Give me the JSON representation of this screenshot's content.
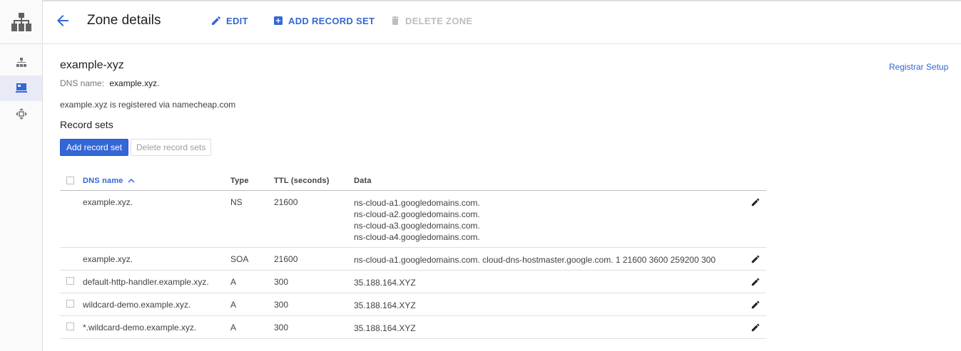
{
  "header": {
    "title": "Zone details",
    "edit_label": "EDIT",
    "add_record_set_label": "ADD RECORD SET",
    "delete_zone_label": "DELETE ZONE"
  },
  "zone": {
    "name": "example-xyz",
    "dns_name_label": "DNS name:",
    "dns_name_value": "example.xyz.",
    "registrar_note": "example.xyz is registered via namecheap.com",
    "registrar_link": "Registrar Setup"
  },
  "record_sets": {
    "title": "Record sets",
    "add_button": "Add record set",
    "delete_button": "Delete record sets",
    "columns": {
      "dns_name": "DNS name",
      "type": "Type",
      "ttl": "TTL (seconds)",
      "data": "Data"
    },
    "rows": [
      {
        "dns_name": "example.xyz.",
        "type": "NS",
        "ttl": "21600",
        "data": [
          "ns-cloud-a1.googledomains.com.",
          "ns-cloud-a2.googledomains.com.",
          "ns-cloud-a3.googledomains.com.",
          "ns-cloud-a4.googledomains.com."
        ],
        "selectable": false
      },
      {
        "dns_name": "example.xyz.",
        "type": "SOA",
        "ttl": "21600",
        "data": [
          "ns-cloud-a1.googledomains.com. cloud-dns-hostmaster.google.com. 1 21600 3600 259200 300"
        ],
        "selectable": false
      },
      {
        "dns_name": "default-http-handler.example.xyz.",
        "type": "A",
        "ttl": "300",
        "data": [
          "35.188.164.XYZ"
        ],
        "selectable": true
      },
      {
        "dns_name": "wildcard-demo.example.xyz.",
        "type": "A",
        "ttl": "300",
        "data": [
          "35.188.164.XYZ"
        ],
        "selectable": true
      },
      {
        "dns_name": "*.wildcard-demo.example.xyz.",
        "type": "A",
        "ttl": "300",
        "data": [
          "35.188.164.XYZ"
        ],
        "selectable": true
      }
    ]
  },
  "colors": {
    "accent": "#3367d6",
    "disabled": "#bdbdbd",
    "nav_active": "#e8eaf6"
  },
  "icons": {
    "brand": "network-services-icon",
    "back": "arrow-back-icon",
    "edit": "pencil-icon",
    "add": "add-box-icon",
    "delete": "trash-icon"
  }
}
